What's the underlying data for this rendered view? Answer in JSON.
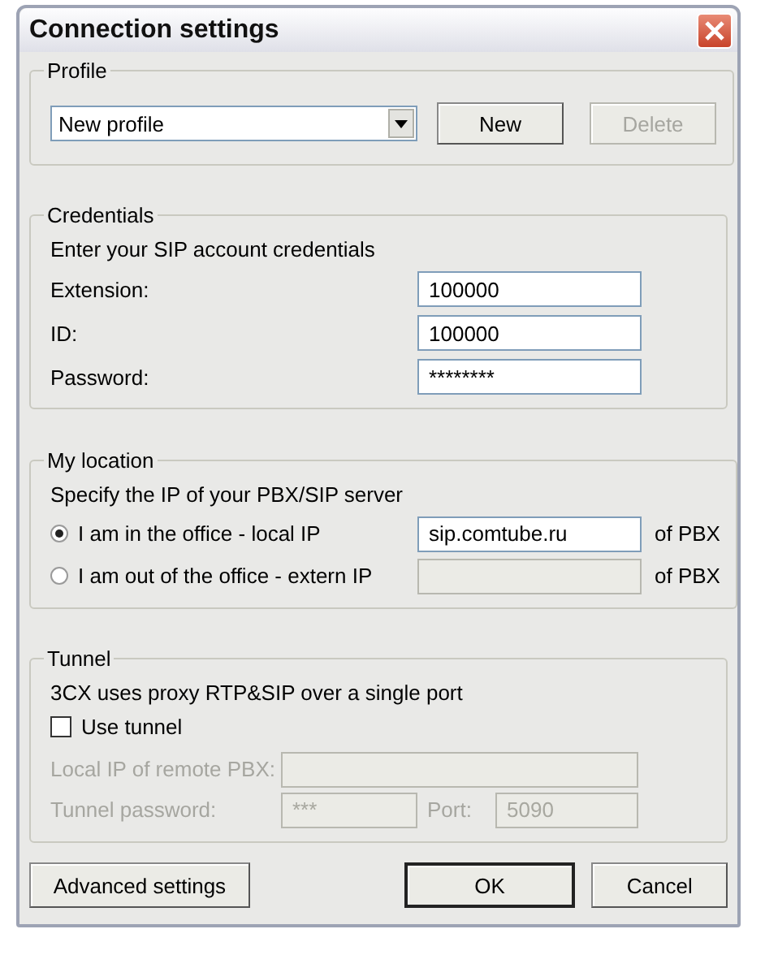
{
  "window": {
    "title": "Connection settings"
  },
  "profile": {
    "legend": "Profile",
    "value": "New profile",
    "buttons": [
      {
        "label": "New",
        "disabled": false
      },
      {
        "label": "Delete",
        "disabled": true
      }
    ]
  },
  "credentials": {
    "legend": "Credentials",
    "hint": "Enter your SIP account credentials",
    "fields": [
      {
        "label": "Extension:",
        "value": "100000"
      },
      {
        "label": "ID:",
        "value": "100000"
      },
      {
        "label": "Password:",
        "value": "********"
      }
    ]
  },
  "location": {
    "legend": "My location",
    "hint": "Specify the IP of your PBX/SIP server",
    "options": [
      {
        "label": "I am in the office - local IP",
        "selected": true,
        "value": "sip.comtube.ru",
        "suffix": "of PBX"
      },
      {
        "label": "I am out of the office - extern IP",
        "selected": false,
        "suffix": "of PBX"
      }
    ]
  },
  "tunnel": {
    "legend": "Tunnel",
    "hint": "3CX uses proxy RTP&SIP over a single port",
    "use_tunnel": {
      "label": "Use tunnel",
      "checked": false
    },
    "remote_ip": {
      "label": "Local IP of remote PBX:",
      "disabled": true
    },
    "password": {
      "label": "Tunnel password:",
      "value": "***",
      "disabled": true
    },
    "port": {
      "label": "Port:",
      "value": "5090",
      "disabled": true
    }
  },
  "footer_buttons": [
    {
      "label": "Advanced settings",
      "default": false
    },
    {
      "label": "OK",
      "default": true
    },
    {
      "label": "Cancel",
      "default": false
    }
  ]
}
